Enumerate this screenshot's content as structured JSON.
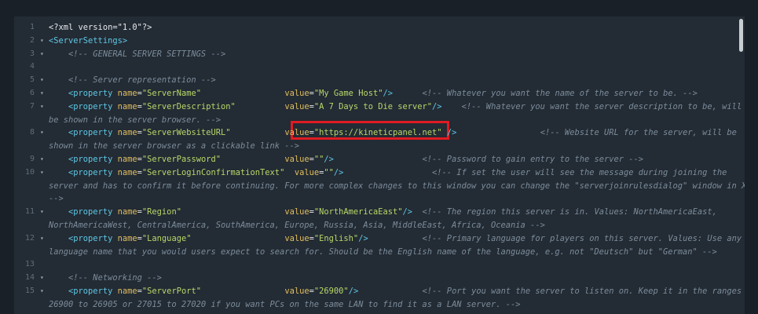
{
  "colors": {
    "tag": "#5ec8e6",
    "attribute": "#e3bf5c",
    "string": "#b8d86a",
    "comment": "#7c8d9c",
    "background": "#232b34",
    "highlight": "#e01b22"
  },
  "lines": [
    {
      "num": "1",
      "fold": "",
      "parts": [
        [
          "punct",
          "<?xml version=\"1.0\"?>"
        ]
      ]
    },
    {
      "num": "2",
      "fold": "▾",
      "parts": [
        [
          "tag",
          "<ServerSettings>"
        ]
      ]
    },
    {
      "num": "3",
      "fold": "▾",
      "parts": [
        [
          "punct",
          "    "
        ],
        [
          "cmt",
          "<!-- GENERAL SERVER SETTINGS -->"
        ]
      ]
    },
    {
      "num": "4",
      "fold": "",
      "parts": []
    },
    {
      "num": "5",
      "fold": "▾",
      "parts": [
        [
          "punct",
          "    "
        ],
        [
          "cmt",
          "<!-- Server representation -->"
        ]
      ]
    },
    {
      "num": "6",
      "fold": "▾",
      "parts": [
        [
          "punct",
          "    "
        ],
        [
          "tag",
          "<property"
        ],
        [
          "punct",
          " "
        ],
        [
          "attr",
          "name"
        ],
        [
          "punct",
          "="
        ],
        [
          "str",
          "\"ServerName\""
        ],
        [
          "punct",
          "                 "
        ],
        [
          "attr",
          "value"
        ],
        [
          "punct",
          "="
        ],
        [
          "str",
          "\"My Game Host\""
        ],
        [
          "tag",
          "/>"
        ],
        [
          "punct",
          "      "
        ],
        [
          "cmt",
          "<!-- Whatever you want the name of the server to be. -->"
        ]
      ]
    },
    {
      "num": "7",
      "fold": "▾",
      "parts": [
        [
          "punct",
          "    "
        ],
        [
          "tag",
          "<property"
        ],
        [
          "punct",
          " "
        ],
        [
          "attr",
          "name"
        ],
        [
          "punct",
          "="
        ],
        [
          "str",
          "\"ServerDescription\""
        ],
        [
          "punct",
          "          "
        ],
        [
          "attr",
          "value"
        ],
        [
          "punct",
          "="
        ],
        [
          "str",
          "\"A 7 Days to Die server\""
        ],
        [
          "tag",
          "/>"
        ],
        [
          "punct",
          "    "
        ],
        [
          "cmt",
          "<!-- Whatever you want the server description to be, will"
        ]
      ]
    },
    {
      "num": "",
      "fold": "",
      "parts": [
        [
          "cmt",
          "be shown in the server browser. -->"
        ]
      ]
    },
    {
      "num": "8",
      "fold": "▾",
      "parts": [
        [
          "punct",
          "    "
        ],
        [
          "tag",
          "<property"
        ],
        [
          "punct",
          " "
        ],
        [
          "attr",
          "name"
        ],
        [
          "punct",
          "="
        ],
        [
          "str",
          "\"ServerWebsiteURL\""
        ],
        [
          "punct",
          "           "
        ],
        [
          "attr",
          "value"
        ],
        [
          "punct",
          "="
        ],
        [
          "str",
          "\"https://kineticpanel.net\""
        ],
        [
          "punct",
          " "
        ],
        [
          "tag",
          "/>"
        ],
        [
          "punct",
          "                 "
        ],
        [
          "cmt",
          "<!-- Website URL for the server, will be"
        ]
      ]
    },
    {
      "num": "",
      "fold": "",
      "parts": [
        [
          "cmt",
          "shown in the server browser as a clickable link -->"
        ]
      ]
    },
    {
      "num": "9",
      "fold": "▾",
      "parts": [
        [
          "punct",
          "    "
        ],
        [
          "tag",
          "<property"
        ],
        [
          "punct",
          " "
        ],
        [
          "attr",
          "name"
        ],
        [
          "punct",
          "="
        ],
        [
          "str",
          "\"ServerPassword\""
        ],
        [
          "punct",
          "             "
        ],
        [
          "attr",
          "value"
        ],
        [
          "punct",
          "="
        ],
        [
          "str",
          "\"\""
        ],
        [
          "tag",
          "/>"
        ],
        [
          "punct",
          "                  "
        ],
        [
          "cmt",
          "<!-- Password to gain entry to the server -->"
        ]
      ]
    },
    {
      "num": "10",
      "fold": "▾",
      "parts": [
        [
          "punct",
          "    "
        ],
        [
          "tag",
          "<property"
        ],
        [
          "punct",
          " "
        ],
        [
          "attr",
          "name"
        ],
        [
          "punct",
          "="
        ],
        [
          "str",
          "\"ServerLoginConfirmationText\""
        ],
        [
          "punct",
          "  "
        ],
        [
          "attr",
          "value"
        ],
        [
          "punct",
          "="
        ],
        [
          "str",
          "\"\""
        ],
        [
          "tag",
          "/>"
        ],
        [
          "punct",
          "                  "
        ],
        [
          "cmt",
          "<!-- If set the user will see the message during joining the"
        ]
      ]
    },
    {
      "num": "",
      "fold": "",
      "parts": [
        [
          "cmt",
          "server and has to confirm it before continuing. For more complex changes to this window you can change the \"serverjoinrulesdialog\" window in XUi"
        ]
      ]
    },
    {
      "num": "",
      "fold": "",
      "parts": [
        [
          "cmt",
          "-->"
        ]
      ]
    },
    {
      "num": "11",
      "fold": "▾",
      "parts": [
        [
          "punct",
          "    "
        ],
        [
          "tag",
          "<property"
        ],
        [
          "punct",
          " "
        ],
        [
          "attr",
          "name"
        ],
        [
          "punct",
          "="
        ],
        [
          "str",
          "\"Region\""
        ],
        [
          "punct",
          "                     "
        ],
        [
          "attr",
          "value"
        ],
        [
          "punct",
          "="
        ],
        [
          "str",
          "\"NorthAmericaEast\""
        ],
        [
          "tag",
          "/>"
        ],
        [
          "punct",
          "  "
        ],
        [
          "cmt",
          "<!-- The region this server is in. Values: NorthAmericaEast,"
        ]
      ]
    },
    {
      "num": "",
      "fold": "",
      "parts": [
        [
          "cmt",
          "NorthAmericaWest, CentralAmerica, SouthAmerica, Europe, Russia, Asia, MiddleEast, Africa, Oceania -->"
        ]
      ]
    },
    {
      "num": "12",
      "fold": "▾",
      "parts": [
        [
          "punct",
          "    "
        ],
        [
          "tag",
          "<property"
        ],
        [
          "punct",
          " "
        ],
        [
          "attr",
          "name"
        ],
        [
          "punct",
          "="
        ],
        [
          "str",
          "\"Language\""
        ],
        [
          "punct",
          "                   "
        ],
        [
          "attr",
          "value"
        ],
        [
          "punct",
          "="
        ],
        [
          "str",
          "\"English\""
        ],
        [
          "tag",
          "/>"
        ],
        [
          "punct",
          "           "
        ],
        [
          "cmt",
          "<!-- Primary language for players on this server. Values: Use any"
        ]
      ]
    },
    {
      "num": "",
      "fold": "",
      "parts": [
        [
          "cmt",
          "language name that you would users expect to search for. Should be the English name of the language, e.g. not \"Deutsch\" but \"German\" -->"
        ]
      ]
    },
    {
      "num": "13",
      "fold": "",
      "parts": []
    },
    {
      "num": "14",
      "fold": "▾",
      "parts": [
        [
          "punct",
          "    "
        ],
        [
          "cmt",
          "<!-- Networking -->"
        ]
      ]
    },
    {
      "num": "15",
      "fold": "▾",
      "parts": [
        [
          "punct",
          "    "
        ],
        [
          "tag",
          "<property"
        ],
        [
          "punct",
          " "
        ],
        [
          "attr",
          "name"
        ],
        [
          "punct",
          "="
        ],
        [
          "str",
          "\"ServerPort\""
        ],
        [
          "punct",
          "                 "
        ],
        [
          "attr",
          "value"
        ],
        [
          "punct",
          "="
        ],
        [
          "str",
          "\"26900\""
        ],
        [
          "tag",
          "/>"
        ],
        [
          "punct",
          "             "
        ],
        [
          "cmt",
          "<!-- Port you want the server to listen on. Keep it in the ranges"
        ]
      ]
    },
    {
      "num": "",
      "fold": "",
      "parts": [
        [
          "cmt",
          "26900 to 26905 or 27015 to 27020 if you want PCs on the same LAN to find it as a LAN server. -->"
        ]
      ]
    }
  ]
}
